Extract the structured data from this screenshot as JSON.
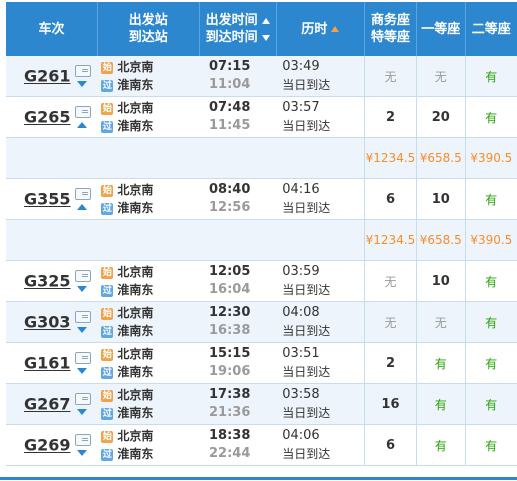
{
  "header": {
    "train": "车次",
    "from_station": "出发站",
    "to_station": "到达站",
    "dep_time": "出发时间",
    "arr_time": "到达时间",
    "duration": "历时",
    "business_1": "商务座",
    "business_2": "特等座",
    "first": "一等座",
    "second": "二等座"
  },
  "badges": {
    "start": "始",
    "pass": "过"
  },
  "rows": [
    {
      "code": "G261",
      "arrow": "down",
      "from": "北京南",
      "to": "淮南东",
      "dep": "07:15",
      "arr": "11:04",
      "dur": "03:49",
      "day": "当日到达",
      "business": "无",
      "first": "无",
      "second": "有"
    },
    {
      "code": "G265",
      "arrow": "up",
      "from": "北京南",
      "to": "淮南东",
      "dep": "07:48",
      "arr": "11:45",
      "dur": "03:57",
      "day": "当日到达",
      "business": "2",
      "first": "20",
      "second": "有"
    },
    {
      "code": "G355",
      "arrow": "up",
      "from": "北京南",
      "to": "淮南东",
      "dep": "08:40",
      "arr": "12:56",
      "dur": "04:16",
      "day": "当日到达",
      "business": "6",
      "first": "10",
      "second": "有"
    },
    {
      "code": "G325",
      "arrow": "down",
      "from": "北京南",
      "to": "淮南东",
      "dep": "12:05",
      "arr": "16:04",
      "dur": "03:59",
      "day": "当日到达",
      "business": "无",
      "first": "10",
      "second": "有"
    },
    {
      "code": "G303",
      "arrow": "down",
      "from": "北京南",
      "to": "淮南东",
      "dep": "12:30",
      "arr": "16:38",
      "dur": "04:08",
      "day": "当日到达",
      "business": "无",
      "first": "无",
      "second": "有"
    },
    {
      "code": "G161",
      "arrow": "down",
      "from": "北京南",
      "to": "淮南东",
      "dep": "15:15",
      "arr": "19:06",
      "dur": "03:51",
      "day": "当日到达",
      "business": "2",
      "first": "有",
      "second": "有"
    },
    {
      "code": "G267",
      "arrow": "down",
      "from": "北京南",
      "to": "淮南东",
      "dep": "17:38",
      "arr": "21:36",
      "dur": "03:58",
      "day": "当日到达",
      "business": "16",
      "first": "有",
      "second": "有"
    },
    {
      "code": "G269",
      "arrow": "down",
      "from": "北京南",
      "to": "淮南东",
      "dep": "18:38",
      "arr": "22:44",
      "dur": "04:06",
      "day": "当日到达",
      "business": "6",
      "first": "有",
      "second": "有"
    }
  ],
  "prices": [
    {
      "business": "¥1234.5",
      "first": "¥658.5",
      "second": "¥390.5"
    },
    {
      "business": "¥1234.5",
      "first": "¥658.5",
      "second": "¥390.5"
    }
  ]
}
